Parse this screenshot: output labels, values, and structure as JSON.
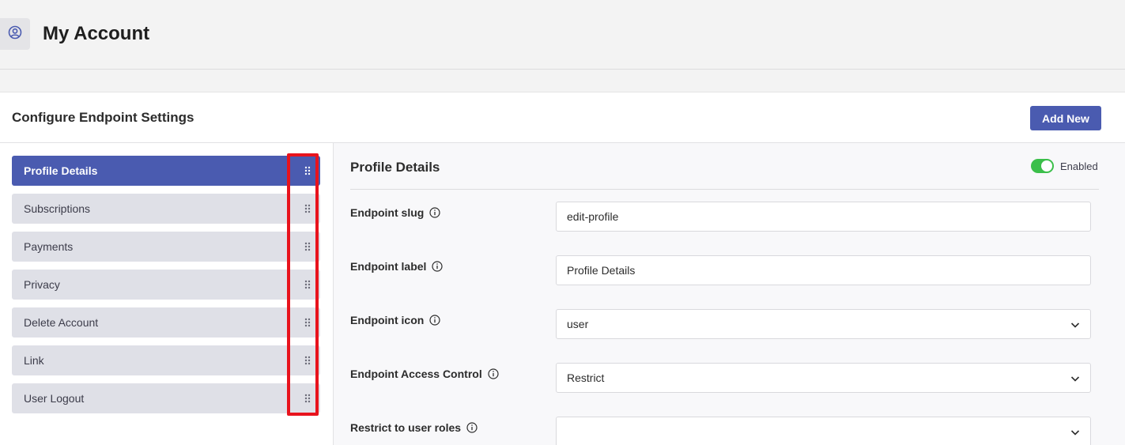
{
  "header": {
    "title": "My Account",
    "icon": "user-circle-icon"
  },
  "panel": {
    "title": "Configure Endpoint Settings",
    "add_new_label": "Add New"
  },
  "endpoints": [
    {
      "label": "Profile Details",
      "active": true
    },
    {
      "label": "Subscriptions",
      "active": false
    },
    {
      "label": "Payments",
      "active": false
    },
    {
      "label": "Privacy",
      "active": false
    },
    {
      "label": "Delete Account",
      "active": false
    },
    {
      "label": "Link",
      "active": false
    },
    {
      "label": "User Logout",
      "active": false
    }
  ],
  "settings": {
    "title": "Profile Details",
    "enabled_label": "Enabled",
    "enabled": true,
    "fields": {
      "slug": {
        "label": "Endpoint slug",
        "value": "edit-profile"
      },
      "label": {
        "label": "Endpoint label",
        "value": "Profile Details"
      },
      "icon": {
        "label": "Endpoint icon",
        "value": "user"
      },
      "access": {
        "label": "Endpoint Access Control",
        "value": "Restrict"
      },
      "roles": {
        "label": "Restrict to user roles",
        "value": ""
      }
    }
  },
  "colors": {
    "accent": "#4a5bb0",
    "toggle_on": "#3bbf4a",
    "highlight": "#e8131d"
  }
}
